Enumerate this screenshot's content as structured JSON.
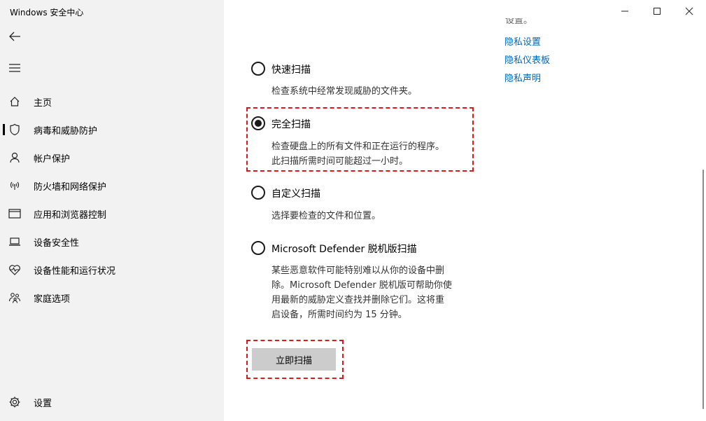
{
  "window": {
    "title": "Windows 安全中心"
  },
  "sidebar": {
    "items": [
      {
        "label": "主页",
        "icon": "home-icon"
      },
      {
        "label": "病毒和威胁防护",
        "icon": "shield-icon",
        "active": true
      },
      {
        "label": "帐户保护",
        "icon": "person-icon"
      },
      {
        "label": "防火墙和网络保护",
        "icon": "wifi-antenna-icon"
      },
      {
        "label": "应用和浏览器控制",
        "icon": "app-window-icon"
      },
      {
        "label": "设备安全性",
        "icon": "laptop-icon"
      },
      {
        "label": "设备性能和运行状况",
        "icon": "heart-pulse-icon"
      },
      {
        "label": "家庭选项",
        "icon": "family-icon"
      }
    ],
    "settings_label": "设置"
  },
  "right_links": {
    "cut_text": "设置。",
    "items": [
      "隐私设置",
      "隐私仪表板",
      "隐私声明"
    ]
  },
  "scan_options": [
    {
      "label": "快速扫描",
      "description": [
        "检查系统中经常发现威胁的文件夹。"
      ],
      "selected": false
    },
    {
      "label": "完全扫描",
      "description": [
        "检查硬盘上的所有文件和正在运行的程序。",
        "此扫描所需时间可能超过一小时。"
      ],
      "selected": true
    },
    {
      "label": "自定义扫描",
      "description": [
        "选择要检查的文件和位置。"
      ],
      "selected": false
    },
    {
      "label": "Microsoft Defender 脱机版扫描",
      "description": [
        "某些恶意软件可能特别难以从你的设备中删",
        "除。Microsoft Defender 脱机版可帮助你使",
        "用最新的威胁定义查找并删除它们。这将重",
        "启设备，所需时间约为 15 分钟。"
      ],
      "selected": false
    }
  ],
  "scan_button_label": "立即扫描",
  "colors": {
    "sidebar_bg": "#f2f2f2",
    "link": "#0067c0",
    "highlight": "#e0161b",
    "button_bg": "#cccccc"
  }
}
